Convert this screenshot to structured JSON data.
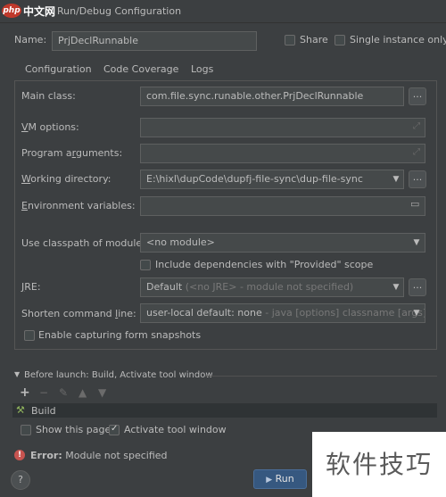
{
  "window": {
    "logo_badge": "php",
    "logo_text": "中文网",
    "title": "Run/Debug Configuration"
  },
  "name_row": {
    "label": "Name:",
    "value": "PrjDeclRunnable",
    "share_label": "Share",
    "single_instance_label": "Single instance only"
  },
  "tabs": [
    "Configuration",
    "Code Coverage",
    "Logs"
  ],
  "config": {
    "main_class_label": "Main class:",
    "main_class_value": "com.file.sync.runable.other.PrjDeclRunnable",
    "vm_options_label": "VM options:",
    "vm_options_value": "",
    "program_args_label": "Program arguments:",
    "program_args_value": "",
    "working_dir_label": "Working directory:",
    "working_dir_value": "E:\\hixl\\dupCode\\dupfj-file-sync\\dup-file-sync",
    "env_vars_label": "Environment variables:",
    "env_vars_value": "",
    "classpath_label": "Use classpath of module:",
    "classpath_value": "<no module>",
    "include_deps_label": "Include dependencies with \"Provided\" scope",
    "jre_label": "JRE:",
    "jre_value": "Default",
    "jre_hint": "(<no JRE> - module not specified)",
    "shorten_label": "Shorten command line:",
    "shorten_value": "user-local default: none",
    "shorten_hint": "- java [options] classname [args]",
    "capture_label": "Enable capturing form snapshots",
    "dots": "..."
  },
  "before_launch": {
    "header": "Before launch: Build, Activate tool window",
    "build_item": "Build",
    "show_page_label": "Show this page",
    "activate_label": "Activate tool window"
  },
  "error": {
    "prefix": "Error:",
    "message": "Module not specified"
  },
  "footer": {
    "help": "?",
    "run": "Run",
    "watermark": "软件技巧"
  },
  "colors": {
    "background": "#3c3f41",
    "field": "#45494a",
    "run_button": "#365880",
    "error": "#c75450"
  }
}
